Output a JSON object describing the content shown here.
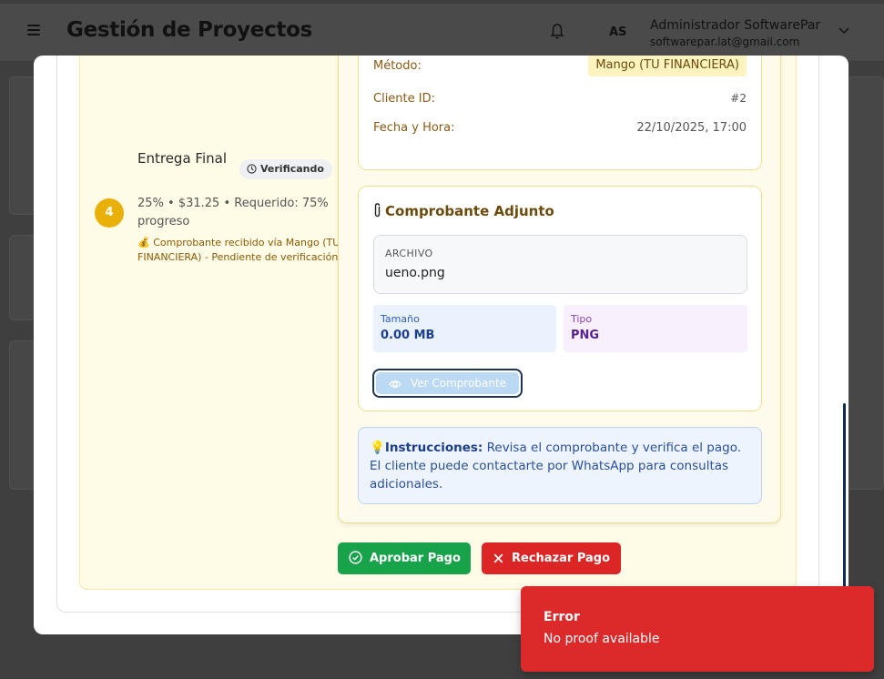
{
  "header": {
    "title": "Gestión de Proyectos",
    "avatar_initials": "AS",
    "user_name": "Administrador SoftwarePar",
    "user_email": "softwarepar.lat@gmail.com"
  },
  "stage": {
    "number": "4",
    "name": "Entrega Final",
    "status": "Verificando",
    "meta": "25% • $31.25 • Requerido: 75% progreso",
    "note": "💰 Comprobante recibido vía Mango (TU FINANCIERA) - Pendiente de verificación"
  },
  "payment_info": {
    "method_label": "Método:",
    "method_value": "Mango (TU FINANCIERA)",
    "client_label": "Cliente ID:",
    "client_value": "#2",
    "datetime_label": "Fecha y Hora:",
    "datetime_value": "22/10/2025, 17:00"
  },
  "proof": {
    "title": "Comprobante Adjunto",
    "file_label": "ARCHIVO",
    "file_name": "ueno.png",
    "size_label": "Tamaño",
    "size_value": "0.00 MB",
    "type_label": "Tipo",
    "type_value": "PNG",
    "view_button": "Ver Comprobante"
  },
  "instructions": {
    "title": "Instrucciones:",
    "text": "Revisa el comprobante y verifica el pago. El cliente puede contactarte por WhatsApp para consultas adicionales."
  },
  "actions": {
    "approve": "Aprobar Pago",
    "reject": "Rechazar Pago"
  },
  "toast": {
    "title": "Error",
    "message": "No proof available"
  },
  "colors": {
    "approve": "#18a34a",
    "reject": "#dc2626",
    "stage_badge": "#e9b008",
    "toast": "#dc2a2a"
  }
}
